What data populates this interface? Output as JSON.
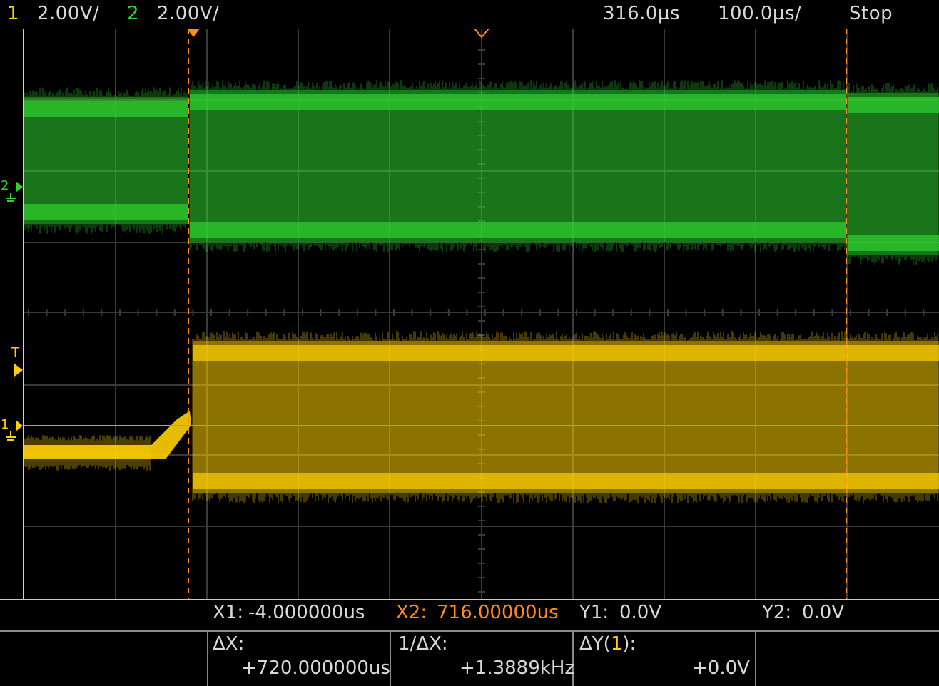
{
  "topbar": {
    "ch1_num": "1",
    "ch1_scale": "2.00V/",
    "ch2_num": "2",
    "ch2_scale": "2.00V/",
    "delay": "316.0µs",
    "timebase": "100.0µs/",
    "run_state": "Stop"
  },
  "markers": {
    "ch2_marker": "2",
    "ch1_marker": "1",
    "trigger_marker": "T"
  },
  "cursors": {
    "x1_label": "X1:",
    "x1_value": "-4.000000us",
    "x2_label": "X2:",
    "x2_value": "716.00000us",
    "y1_label": "Y1:",
    "y1_value": "0.0V",
    "y2_label": "Y2:",
    "y2_value": "0.0V",
    "dx_label": "ΔX:",
    "dx_value": "+720.000000us",
    "inv_dx_label": "1/ΔX:",
    "inv_dx_value": "+1.3889kHz",
    "dy_label_prefix": "ΔY(",
    "dy_label_ch": "1",
    "dy_label_suffix": "):",
    "dy_value": "+0.0V"
  },
  "colors": {
    "ch1": "#ffd000",
    "ch2": "#2fd12f",
    "cursor": "#ff8c1a",
    "grid": "#3a3a3a"
  }
}
